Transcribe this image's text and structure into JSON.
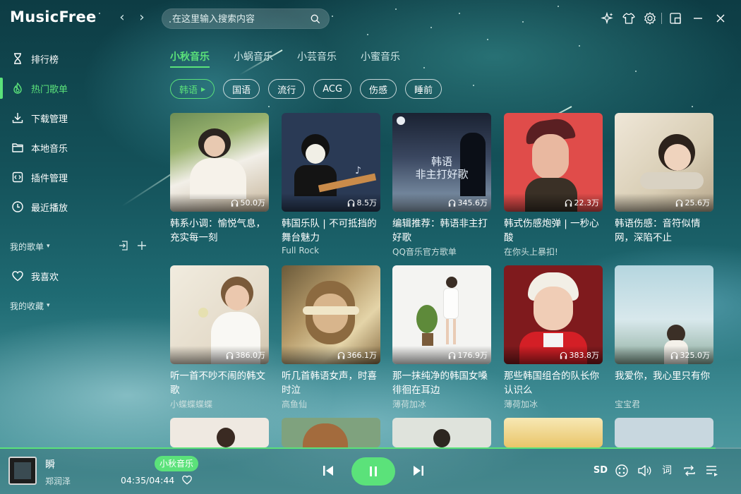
{
  "app": {
    "logo": "MusicFree"
  },
  "search": {
    "placeholder": "在这里输入搜索内容"
  },
  "sidebar": {
    "items": [
      {
        "label": "排行榜",
        "icon": "ranking-icon"
      },
      {
        "label": "热门歌单",
        "icon": "hot-playlist-icon",
        "active": true
      },
      {
        "label": "下载管理",
        "icon": "download-icon"
      },
      {
        "label": "本地音乐",
        "icon": "folder-icon"
      },
      {
        "label": "插件管理",
        "icon": "plugin-icon"
      },
      {
        "label": "最近播放",
        "icon": "clock-icon"
      }
    ],
    "my_playlists": {
      "label": "我的歌单"
    },
    "favorites_item": {
      "label": "我喜欢",
      "icon": "heart-icon"
    },
    "my_collections": {
      "label": "我的收藏"
    }
  },
  "tabs": [
    {
      "label": "小秋音乐",
      "active": true
    },
    {
      "label": "小蜗音乐"
    },
    {
      "label": "小芸音乐"
    },
    {
      "label": "小蜜音乐"
    }
  ],
  "tags": [
    {
      "label": "韩语",
      "active": true
    },
    {
      "label": "国语"
    },
    {
      "label": "流行"
    },
    {
      "label": "ACG"
    },
    {
      "label": "伤感"
    },
    {
      "label": "睡前"
    }
  ],
  "playlists": [
    {
      "title": "韩系小调：愉悦气息，充实每一刻",
      "subtitle": "",
      "plays": "50.0万"
    },
    {
      "title": "韩国乐队 | 不可抵挡的舞台魅力",
      "subtitle": "Full Rock",
      "plays": "8.5万"
    },
    {
      "title": "编辑推荐：韩语非主打好歌",
      "subtitle": "QQ音乐官方歌单",
      "plays": "345.6万",
      "cover_text": [
        "韩语",
        "非主打好歌"
      ]
    },
    {
      "title": "韩式伤感炮弹 | 一秒心酸",
      "subtitle": "在你头上暴扣!",
      "plays": "22.3万"
    },
    {
      "title": "韩语伤感：音符似情网，深陷不止",
      "subtitle": "",
      "plays": "25.6万"
    },
    {
      "title": "听一首不吵不闹的韩文歌",
      "subtitle": "小蝶蝶蝶蝶",
      "plays": "386.0万"
    },
    {
      "title": "听几首韩语女声，时喜时泣",
      "subtitle": "高鱼仙",
      "plays": "366.1万"
    },
    {
      "title": "那一抹纯净的韩国女嗓徘徊在耳边",
      "subtitle": "薄荷加冰",
      "plays": "176.9万"
    },
    {
      "title": "那些韩国组合的队长你认识么",
      "subtitle": "薄荷加冰",
      "plays": "383.8万"
    },
    {
      "title": "我爱你，我心里只有你",
      "subtitle": "宝宝君",
      "plays": "325.0万"
    }
  ],
  "player": {
    "title": "瞬",
    "artist": "郑润泽",
    "source": "小秋音乐",
    "time": "04:35/04:44",
    "progress": 0.966,
    "quality": "SD",
    "lyric_label": "词"
  },
  "colors": {
    "accent": "#5be27a"
  }
}
